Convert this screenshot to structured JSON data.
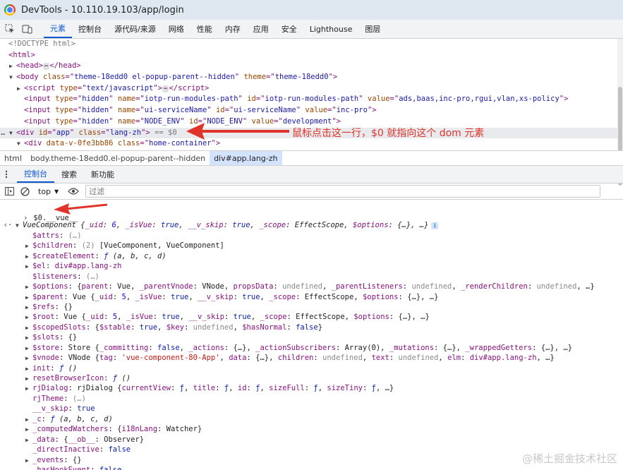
{
  "window": {
    "title": "DevTools - 10.110.19.103/app/login"
  },
  "devtools_tabs": [
    "元素",
    "控制台",
    "源代码/来源",
    "网络",
    "性能",
    "内存",
    "应用",
    "安全",
    "Lighthouse",
    "图层"
  ],
  "elements_lines": [
    {
      "indent": 0,
      "tri": "",
      "html": "<span class='cm'>&lt;!DOCTYPE html&gt;</span>"
    },
    {
      "indent": 0,
      "tri": "",
      "html": "<span class='tag'>&lt;html&gt;</span>"
    },
    {
      "indent": 1,
      "tri": "▶",
      "html": "<span class='tag'>&lt;head&gt;</span><span class='dots'>⋯</span><span class='tag'>&lt;/head&gt;</span>"
    },
    {
      "indent": 1,
      "tri": "▼",
      "html": "<span class='tag'>&lt;body </span><span class='an'>class</span><span class='tag'>=\"</span><span class='av'>theme-18edd0 el-popup-parent--hidden</span><span class='tag'>\" </span><span class='an'>theme</span><span class='tag'>=\"</span><span class='av'>theme-18edd0</span><span class='tag'>\"&gt;</span>"
    },
    {
      "indent": 2,
      "tri": "▶",
      "html": "<span class='tag'>&lt;script </span><span class='an'>type</span><span class='tag'>=\"</span><span class='av'>text/javascript</span><span class='tag'>\"&gt;</span><span class='dots'>⋯</span><span class='tag'>&lt;/script&gt;</span>"
    },
    {
      "indent": 2,
      "tri": "",
      "html": "<span class='tag'>&lt;input </span><span class='an'>type</span><span class='tag'>=\"</span><span class='av'>hidden</span><span class='tag'>\" </span><span class='an'>name</span><span class='tag'>=\"</span><span class='av'>iotp-run-modules-path</span><span class='tag'>\" </span><span class='an'>id</span><span class='tag'>=\"</span><span class='av'>iotp-run-modules-path</span><span class='tag'>\" </span><span class='an'>value</span><span class='tag'>=\"</span><span class='av'>ads,baas,inc-pro,rgui,vlan,xs-policy</span><span class='tag'>\"&gt;</span>"
    },
    {
      "indent": 2,
      "tri": "",
      "html": "<span class='tag'>&lt;input </span><span class='an'>type</span><span class='tag'>=\"</span><span class='av'>hidden</span><span class='tag'>\" </span><span class='an'>name</span><span class='tag'>=\"</span><span class='av'>ui-serviceName</span><span class='tag'>\" </span><span class='an'>id</span><span class='tag'>=\"</span><span class='av'>ui-serviceName</span><span class='tag'>\" </span><span class='an'>value</span><span class='tag'>=\"</span><span class='av'>inc-pro</span><span class='tag'>\"&gt;</span>"
    },
    {
      "indent": 2,
      "tri": "",
      "html": "<span class='tag'>&lt;input </span><span class='an'>type</span><span class='tag'>=\"</span><span class='av'>hidden</span><span class='tag'>\" </span><span class='an'>name</span><span class='tag'>=\"</span><span class='av'>NODE_ENV</span><span class='tag'>\" </span><span class='an'>id</span><span class='tag'>=\"</span><span class='av'>NODE_ENV</span><span class='tag'>\" </span><span class='an'>value</span><span class='tag'>=\"</span><span class='av'>development</span><span class='tag'>\"&gt;</span>"
    },
    {
      "indent": 1,
      "tri": "▼",
      "sel": true,
      "html": "<span class='tag'>&lt;div </span><span class='an'>id</span><span class='tag'>=\"</span><span class='av'>app</span><span class='tag'>\" </span><span class='an'>class</span><span class='tag'>=\"</span><span class='av'>lang-zh</span><span class='tag'>\"&gt;</span> <span class='cm'>== $0</span>"
    },
    {
      "indent": 2,
      "tri": "▼",
      "html": "<span class='tag'>&lt;div </span><span class='an'>data-v-0fe3bb86</span><span class='tag'> </span><span class='an'>class</span><span class='tag'>=\"</span><span class='av'>home-container</span><span class='tag'>\"&gt;</span>"
    }
  ],
  "selected_gutter": "…",
  "annotation": "鼠标点击这一行，$0 就指向这个 dom 元素",
  "breadcrumbs": [
    "html",
    "body.theme-18edd0.el-popup-parent--hidden",
    "div#app.lang-zh"
  ],
  "drawer_tabs": [
    "控制台",
    "搜索",
    "新功能"
  ],
  "console_toolbar": {
    "context": "top",
    "filter_placeholder": "过滤"
  },
  "console_input": "$0.__vue__",
  "console_lines": [
    {
      "p": "‹·",
      "t": "▼",
      "lvl": 0,
      "html": "<i>VueComponent {<span class='key'>_uid</span>: <span class='num'>6</span>, <span class='key'>_isVue</span>: <span class='kw'>true</span>, <span class='key'>__v_skip</span>: <span class='kw'>true</span>, <span class='key'>_scope</span>: EffectScope, <span class='key'>$options</span>: {…}, …}</i><span class='i-icon'>i</span>"
    },
    {
      "t": "",
      "lvl": 1,
      "html": "<span class='key'>$attrs</span>: <span class='gray'>(…)</span>"
    },
    {
      "t": "▶",
      "lvl": 1,
      "html": "<span class='key'>$children</span>: <span class='gray'>(2)</span> [VueComponent, VueComponent]"
    },
    {
      "t": "▶",
      "lvl": 1,
      "html": "<span class='key'>$createElement</span>: <i><span class='kw'>ƒ</span> (a, b, c, d)</i>"
    },
    {
      "t": "▶",
      "lvl": 1,
      "html": "<span class='key'>$el</span>: <span class='tag'>div#app.lang-zh</span>"
    },
    {
      "t": "",
      "lvl": 1,
      "html": "<span class='key'>$listeners</span>: <span class='gray'>(…)</span>"
    },
    {
      "t": "▶",
      "lvl": 1,
      "html": "<span class='key'>$options</span>: {<span class='key'>parent</span>: Vue, <span class='key'>_parentVnode</span>: VNode, <span class='key'>propsData</span>: <span class='gray'>undefined</span>, <span class='key'>_parentListeners</span>: <span class='gray'>undefined</span>, <span class='key'>_renderChildren</span>: <span class='gray'>undefined</span>, …}"
    },
    {
      "t": "▶",
      "lvl": 1,
      "html": "<span class='key'>$parent</span>: Vue {<span class='key'>_uid</span>: <span class='num'>5</span>, <span class='key'>_isVue</span>: <span class='kw'>true</span>, <span class='key'>__v_skip</span>: <span class='kw'>true</span>, <span class='key'>_scope</span>: EffectScope, <span class='key'>$options</span>: {…}, …}"
    },
    {
      "t": "▶",
      "lvl": 1,
      "html": "<span class='key'>$refs</span>: {}"
    },
    {
      "t": "▶",
      "lvl": 1,
      "html": "<span class='key'>$root</span>: Vue {<span class='key'>_uid</span>: <span class='num'>5</span>, <span class='key'>_isVue</span>: <span class='kw'>true</span>, <span class='key'>__v_skip</span>: <span class='kw'>true</span>, <span class='key'>_scope</span>: EffectScope, <span class='key'>$options</span>: {…}, …}"
    },
    {
      "t": "▶",
      "lvl": 1,
      "html": "<span class='key'>$scopedSlots</span>: {<span class='key'>$stable</span>: <span class='kw'>true</span>, <span class='key'>$key</span>: <span class='gray'>undefined</span>, <span class='key'>$hasNormal</span>: <span class='kw'>false</span>}"
    },
    {
      "t": "▶",
      "lvl": 1,
      "html": "<span class='key'>$slots</span>: {}"
    },
    {
      "t": "▶",
      "lvl": 1,
      "html": "<span class='key'>$store</span>: Store {<span class='key'>_committing</span>: <span class='kw'>false</span>, <span class='key'>_actions</span>: {…}, <span class='key'>_actionSubscribers</span>: Array(0), <span class='key'>_mutations</span>: {…}, <span class='key'>_wrappedGetters</span>: {…}, …}"
    },
    {
      "t": "▶",
      "lvl": 1,
      "html": "<span class='key'>$vnode</span>: VNode {<span class='key'>tag</span>: <span class='str'>'vue-component-80-App'</span>, <span class='key'>data</span>: {…}, <span class='key'>children</span>: <span class='gray'>undefined</span>, <span class='key'>text</span>: <span class='gray'>undefined</span>, <span class='key'>elm</span>: <span class='tag'>div#app.lang-zh</span>, …}"
    },
    {
      "t": "▶",
      "lvl": 1,
      "html": "<span class='key'>init</span>: <i><span class='kw'>ƒ</span> ()</i>"
    },
    {
      "t": "▶",
      "lvl": 1,
      "html": "<span class='key'>resetBrowserIcon</span>: <i><span class='kw'>ƒ</span> ()</i>"
    },
    {
      "t": "▶",
      "lvl": 1,
      "html": "<span class='key'>rjDialog</span>: rjDialog {<span class='key'>currentView</span>: <span class='kw'>ƒ</span>, <span class='key'>title</span>: <span class='kw'>ƒ</span>, <span class='key'>id</span>: <span class='kw'>ƒ</span>, <span class='key'>sizeFull</span>: <span class='kw'>ƒ</span>, <span class='key'>sizeTiny</span>: <span class='kw'>ƒ</span>, …}"
    },
    {
      "t": "",
      "lvl": 1,
      "html": "<span class='key'>rjTheme</span>: <span class='gray'>(…)</span>"
    },
    {
      "t": "",
      "lvl": 1,
      "html": "<span class='key'>__v_skip</span>: <span class='kw'>true</span>"
    },
    {
      "t": "▶",
      "lvl": 1,
      "html": "<span class='key'>_c</span>: <i><span class='kw'>ƒ</span> (a, b, c, d)</i>"
    },
    {
      "t": "▶",
      "lvl": 1,
      "html": "<span class='key'>_computedWatchers</span>: {<span class='key'>i18nLang</span>: Watcher}"
    },
    {
      "t": "▶",
      "lvl": 1,
      "html": "<span class='key'>_data</span>: {<span class='key'>__ob__</span>: Observer}"
    },
    {
      "t": "",
      "lvl": 1,
      "html": "<span class='key'>_directInactive</span>: <span class='kw'>false</span>"
    },
    {
      "t": "▶",
      "lvl": 1,
      "html": "<span class='key'>_events</span>: {}"
    },
    {
      "t": "",
      "lvl": 1,
      "html": "<span class='key'>_hasHookEvent</span>: <span class='kw'>false</span>"
    }
  ],
  "watermark": "@稀土掘金技术社区",
  "colors": {
    "accent": "#0b57d0",
    "annotation": "#e0342b"
  }
}
